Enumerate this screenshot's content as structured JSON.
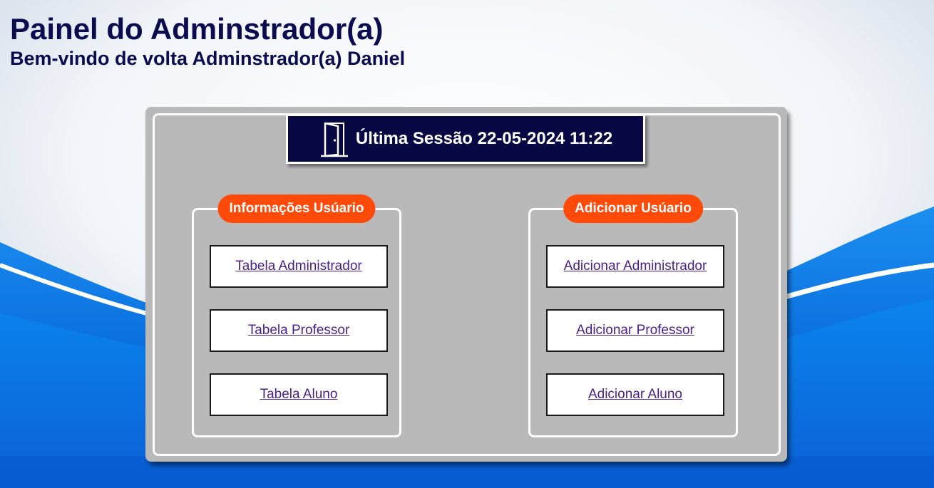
{
  "header": {
    "title": "Painel do Adminstrador(a)",
    "subtitle": "Bem-vindo de volta Adminstrador(a) Daniel"
  },
  "session": {
    "label": "Última Sessão 22-05-2024 11:22",
    "icon": "door-icon"
  },
  "info_group": {
    "label": "Informações Usúario",
    "links": [
      "Tabela Administrador",
      "Tabela Professor",
      "Tabela Aluno"
    ]
  },
  "add_group": {
    "label": "Adicionar Usúario",
    "links": [
      "Adicionar Administrador",
      "Adicionar Professor",
      "Adicionar Aluno"
    ]
  },
  "colors": {
    "title": "#0b0b4f",
    "session_bg": "#070744",
    "badge": "#ff4a0a",
    "panel": "#b9b9b9",
    "link": "#4b1f8a",
    "wave_blue": "#0a78e8"
  }
}
